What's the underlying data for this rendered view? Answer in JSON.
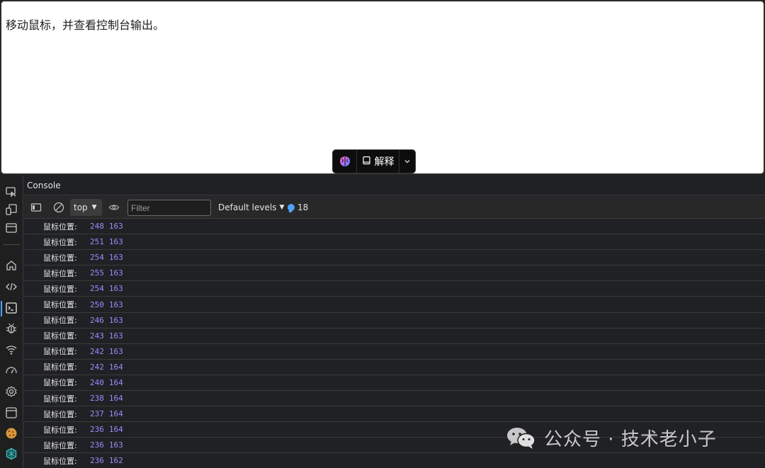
{
  "page": {
    "instruction_text": "移动鼠标，并查看控制台输出。"
  },
  "ai_toolbar": {
    "explain_label": "解释",
    "brain_icon": "brain-icon",
    "book_icon": "book-icon",
    "chevron_icon": "chevron-down-icon"
  },
  "console": {
    "tab_label": "Console",
    "context_value": "top",
    "filter_placeholder": "Filter",
    "levels_label": "Default levels",
    "message_count": "18",
    "log_label": "鼠标位置:",
    "logs": [
      {
        "x": "248",
        "y": "163"
      },
      {
        "x": "251",
        "y": "163"
      },
      {
        "x": "254",
        "y": "163"
      },
      {
        "x": "255",
        "y": "163"
      },
      {
        "x": "254",
        "y": "163"
      },
      {
        "x": "250",
        "y": "163"
      },
      {
        "x": "246",
        "y": "163"
      },
      {
        "x": "243",
        "y": "163"
      },
      {
        "x": "242",
        "y": "163"
      },
      {
        "x": "242",
        "y": "164"
      },
      {
        "x": "240",
        "y": "164"
      },
      {
        "x": "238",
        "y": "164"
      },
      {
        "x": "237",
        "y": "164"
      },
      {
        "x": "236",
        "y": "164"
      },
      {
        "x": "236",
        "y": "163"
      },
      {
        "x": "236",
        "y": "162"
      }
    ]
  },
  "sidebar": {
    "icons": [
      "inspect-icon",
      "device-toggle-icon",
      "dock-icon",
      "home-icon",
      "elements-icon",
      "console-icon",
      "sources-bug-icon",
      "network-icon",
      "performance-icon",
      "settings-icon",
      "application-icon",
      "cookie-icon",
      "extension-icon"
    ]
  },
  "watermark": {
    "text": "公众号 · 技术老小子"
  }
}
